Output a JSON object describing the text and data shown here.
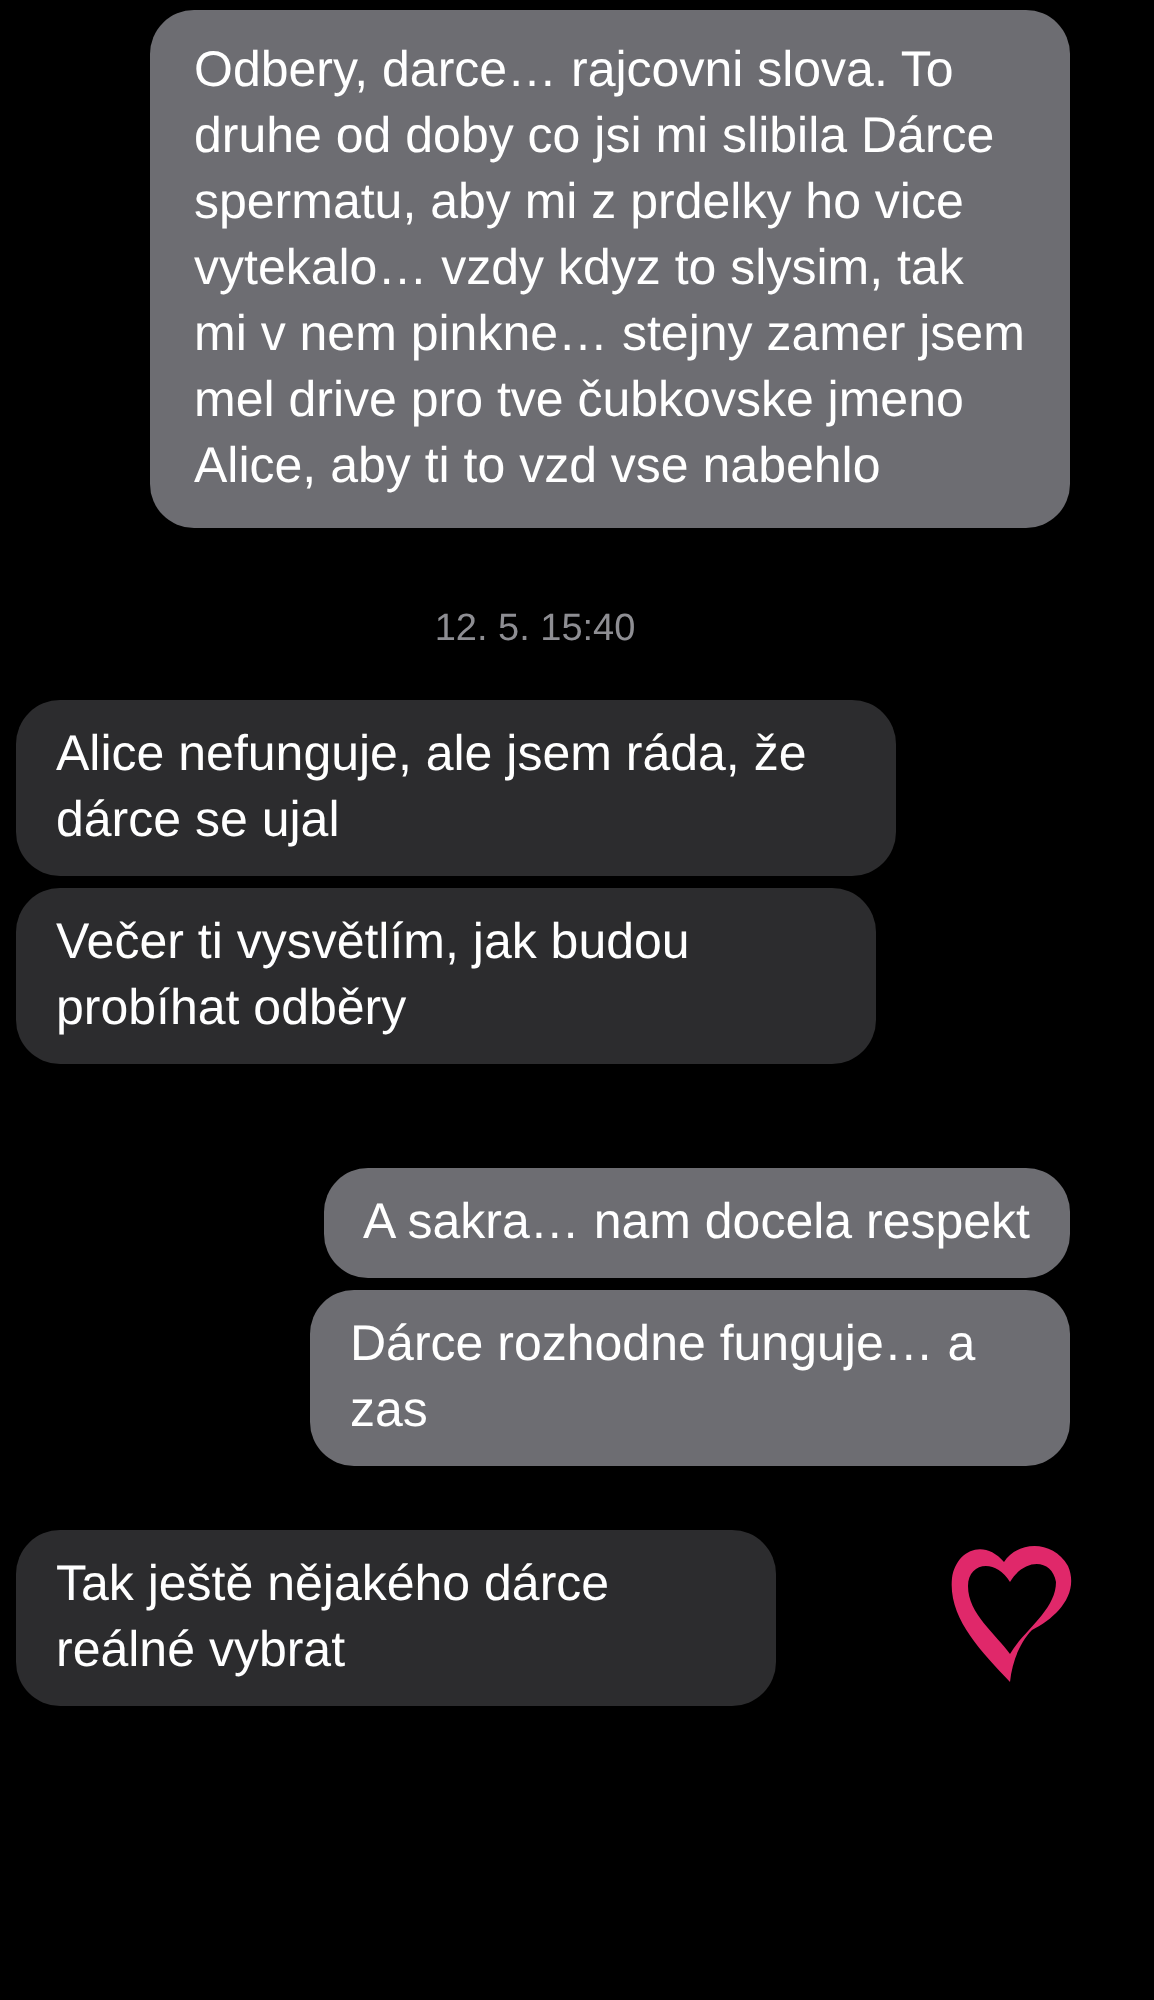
{
  "messages": [
    {
      "kind": "outgoing",
      "text": "Odbery, darce… rajcovni slova. To druhe od doby co jsi mi slibila Dárce spermatu, aby mi z prdelky ho vice vytekalo… vzdy kdyz to slysim, tak mi v nem pinkne… stejny zamer jsem mel drive pro tve čubkovske jmeno Alice, aby ti to vzd vse nabehlo"
    },
    {
      "kind": "timestamp",
      "text": "12. 5. 15:40"
    },
    {
      "kind": "incoming",
      "text": "Alice nefunguje, ale jsem ráda, že dárce se ujal"
    },
    {
      "kind": "incoming",
      "text": "Večer ti vysvětlím, jak budou probíhat odběry"
    },
    {
      "kind": "outgoing",
      "text": "A sakra… nam docela respekt"
    },
    {
      "kind": "outgoing",
      "text": "Dárce rozhodne funguje… a zas"
    },
    {
      "kind": "incoming",
      "text": "Tak ještě nějakého dárce reálné vybrat",
      "heart": true
    }
  ]
}
